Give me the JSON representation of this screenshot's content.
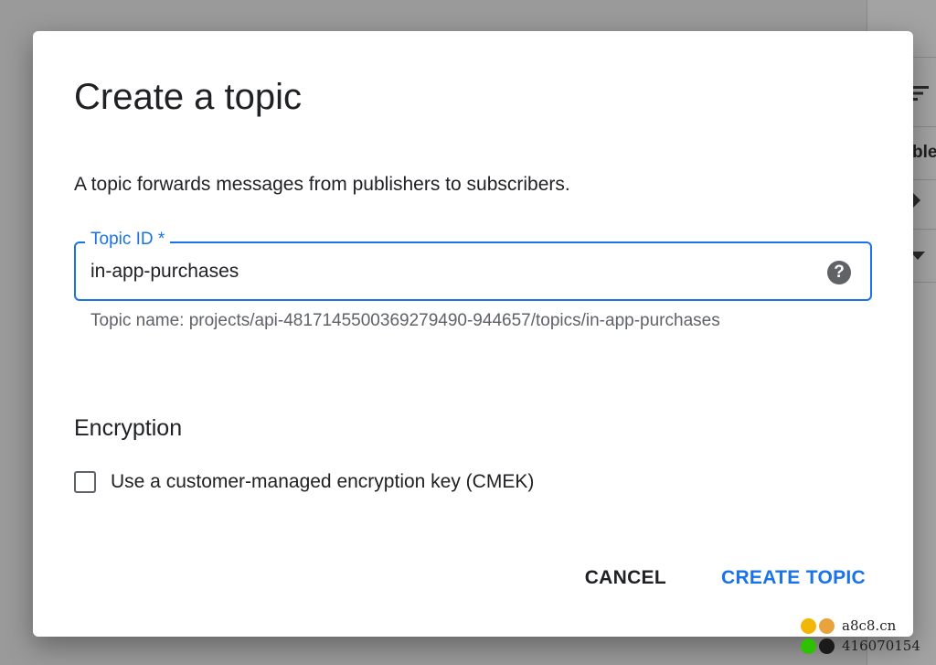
{
  "dialog": {
    "title": "Create a topic",
    "description": "A topic forwards messages from publishers to subscribers.",
    "topic_id_field": {
      "label": "Topic ID *",
      "value": "in-app-purchases",
      "help_icon": "help-circle-icon",
      "hint": "Topic name: projects/api-4817145500369279490-944657/topics/in-app-purchases"
    },
    "encryption": {
      "heading": "Encryption",
      "cmek_label": "Use a customer-managed encryption key (CMEK)",
      "cmek_checked": false
    },
    "actions": {
      "cancel_label": "CANCEL",
      "create_label": "CREATE TOPIC"
    }
  },
  "background": {
    "partial_text": "ble",
    "icons": [
      "filter-icon",
      "caret-right-icon",
      "caret-down-icon"
    ]
  },
  "watermark": {
    "site": "a8c8.cn",
    "number": "416070154"
  },
  "colors": {
    "accent": "#1a73e8",
    "text_primary": "#202124",
    "text_secondary": "#5f6368",
    "scrim": "#8e8e8e"
  }
}
